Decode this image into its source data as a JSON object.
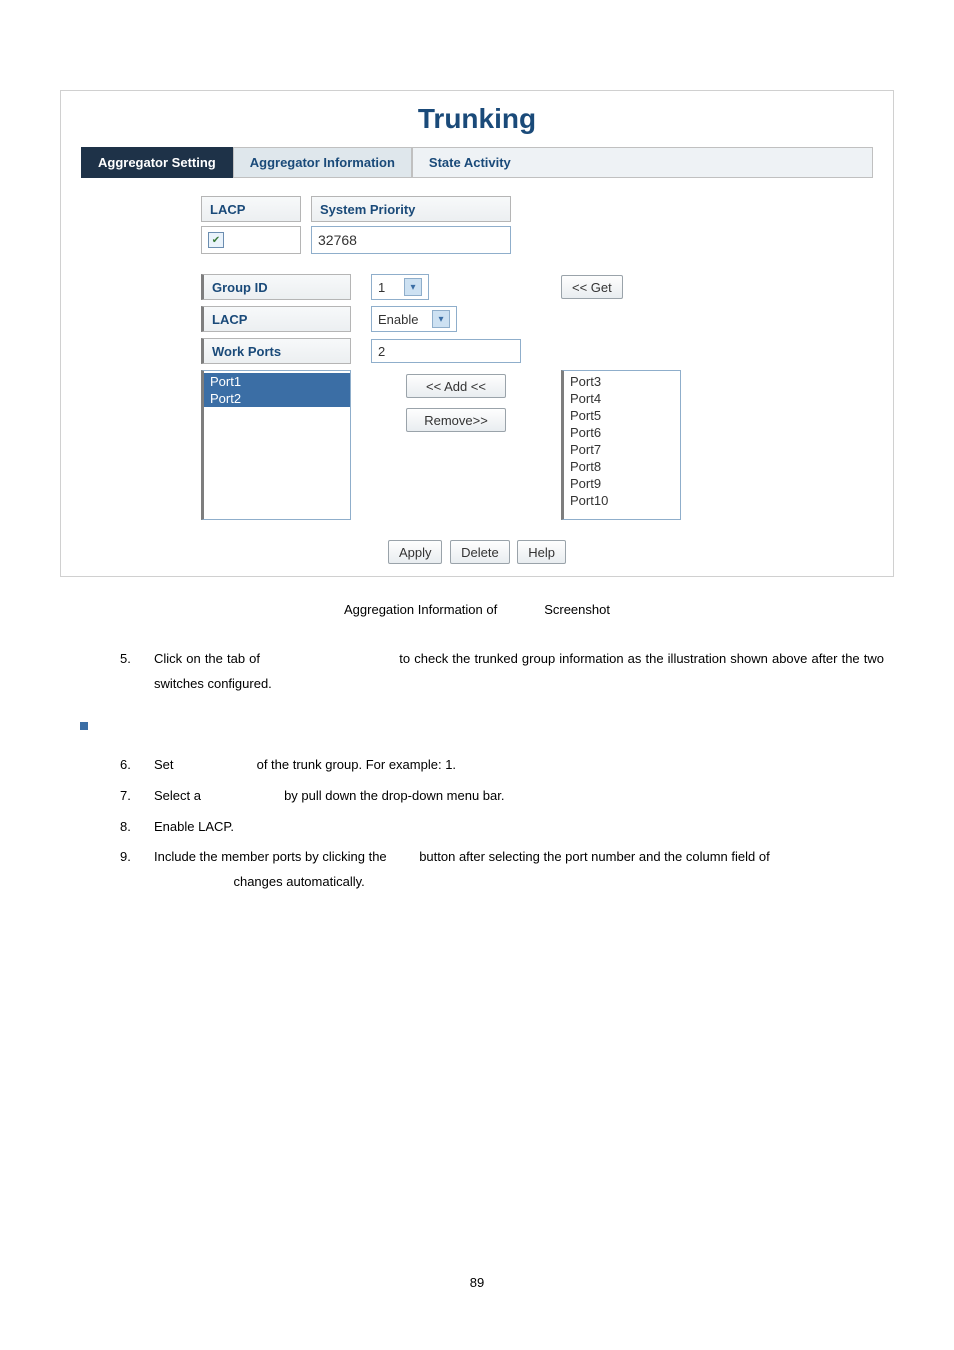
{
  "screenshot": {
    "title": "Trunking",
    "tabs": {
      "active": "Aggregator Setting",
      "middle": "Aggregator Information",
      "right": "State Activity"
    },
    "lacp_label": "LACP",
    "system_priority_label": "System Priority",
    "system_priority_value": "32768",
    "lacp_checked": true,
    "group_id_label": "Group ID",
    "group_id_value": "1",
    "lacp_row_label": "LACP",
    "lacp_select_value": "Enable",
    "work_ports_label": "Work Ports",
    "work_ports_value": "2",
    "selected_ports": [
      "Port1",
      "Port2"
    ],
    "available_ports": [
      "Port3",
      "Port4",
      "Port5",
      "Port6",
      "Port7",
      "Port8",
      "Port9",
      "Port10"
    ],
    "btn_get": "<< Get",
    "btn_add": "<< Add <<",
    "btn_remove": "Remove>>",
    "btn_apply": "Apply",
    "btn_delete": "Delete",
    "btn_help": "Help"
  },
  "caption": {
    "left": "Aggregation Information of",
    "right": "Screenshot"
  },
  "steps_a": {
    "n5": "5.",
    "t5a": "Click on the tab of",
    "t5b": "to check the trunked group information as the illustration shown above after the two switches configured."
  },
  "steps_b": {
    "n6": "6.",
    "t6a": "Set",
    "t6b": "of the trunk group. For example: 1.",
    "n7": "7.",
    "t7a": "Select a",
    "t7b": "by pull down the drop-down menu bar.",
    "n8": "8.",
    "t8": "Enable LACP.",
    "n9": "9.",
    "t9a": "Include the member ports by clicking the",
    "t9b": "button after selecting the port number and the column field of",
    "t9c": "changes automatically."
  },
  "page_number": "89"
}
